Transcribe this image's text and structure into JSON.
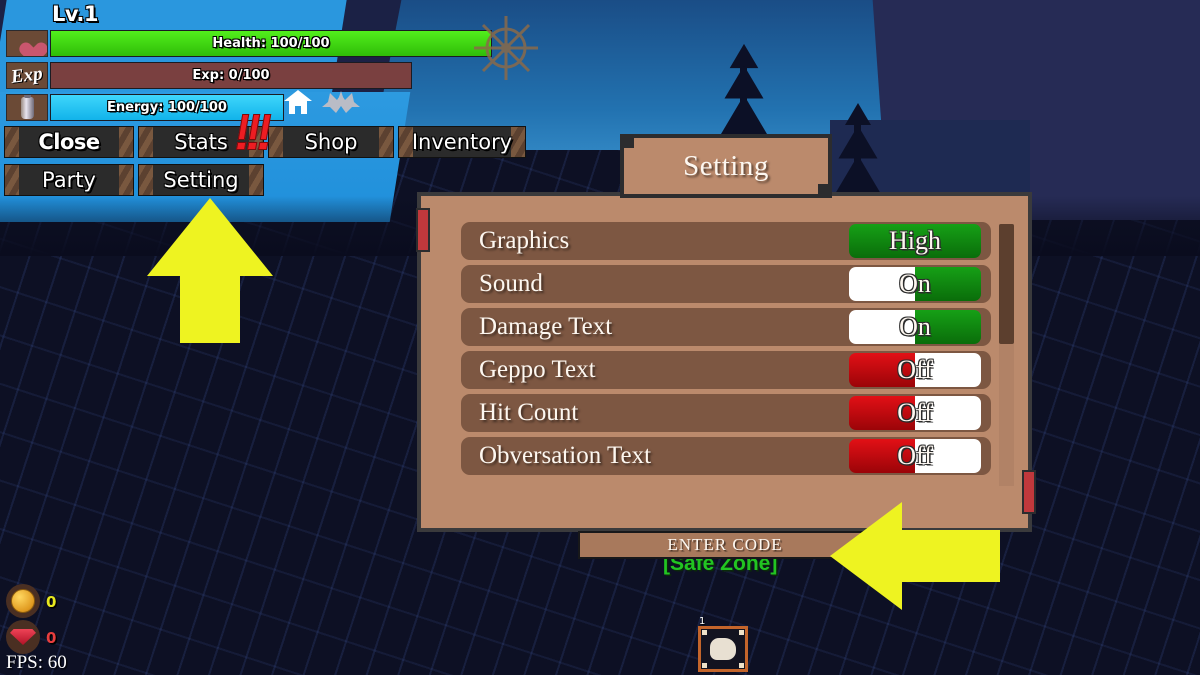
{
  "hud": {
    "level_label": "Lv.1",
    "bars": [
      {
        "name": "health",
        "icon": "heart-icon",
        "text": "Health: 100/100",
        "fill_percent": 100,
        "color": "#3ddb0e",
        "track_color": "#2f5a20"
      },
      {
        "name": "exp",
        "icon": "exp-icon",
        "icon_text": "Exp",
        "text": "Exp: 0/100",
        "fill_percent": 0,
        "color": "#8a3a3a",
        "track_color": "#7a4040"
      },
      {
        "name": "energy",
        "icon": "bottle-icon",
        "text": "Energy: 100/100",
        "fill_percent": 100,
        "color": "#1ec8f5",
        "track_color": "#1a5f80"
      }
    ],
    "indicators": [
      {
        "name": "house-icon",
        "label": "house"
      },
      {
        "name": "bat-icon",
        "label": "bat"
      },
      {
        "name": "ship-wheel-icon",
        "label": "ship wheel"
      }
    ],
    "notification_badge": "!!!"
  },
  "menu": {
    "row1": [
      {
        "id": "close",
        "label": "Close",
        "bold": true
      },
      {
        "id": "stats",
        "label": "Stats",
        "bold": false
      },
      {
        "id": "shop",
        "label": "Shop",
        "bold": false
      },
      {
        "id": "inventory",
        "label": "Inventory",
        "bold": false
      }
    ],
    "row2": [
      {
        "id": "party",
        "label": "Party",
        "bold": false
      },
      {
        "id": "setting",
        "label": "Setting",
        "bold": false
      }
    ]
  },
  "settings": {
    "title": "Setting",
    "rows": [
      {
        "id": "graphics",
        "label": "Graphics",
        "value": "High",
        "state": "full"
      },
      {
        "id": "sound",
        "label": "Sound",
        "value": "On",
        "state": "on"
      },
      {
        "id": "damage-text",
        "label": "Damage Text",
        "value": "On",
        "state": "on"
      },
      {
        "id": "geppo-text",
        "label": "Geppo Text",
        "value": "Off",
        "state": "off"
      },
      {
        "id": "hit-count",
        "label": "Hit Count",
        "value": "Off",
        "state": "off"
      },
      {
        "id": "obversation-text",
        "label": "Obversation Text",
        "value": "Off",
        "state": "off"
      }
    ],
    "enter_code_label": "ENTER CODE"
  },
  "world": {
    "zone_label": "[Safe Zone]"
  },
  "footer": {
    "coins": "0",
    "gems": "0",
    "fps": "FPS: 60",
    "hotbar_slot_number": "1"
  },
  "colors": {
    "panel": "#bb8a6c",
    "row": "#7d5742",
    "toggle_on": "#0f8a0f",
    "toggle_off": "#d21016",
    "arrow": "#eef321",
    "zone_text": "#22c522"
  }
}
